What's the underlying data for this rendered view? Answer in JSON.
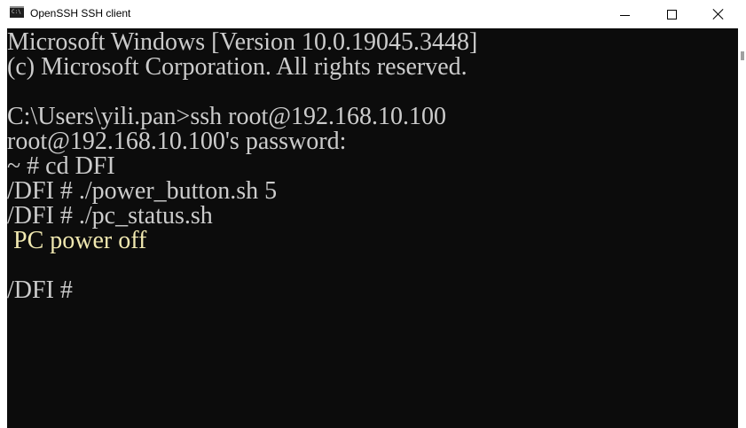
{
  "window": {
    "title": "OpenSSH SSH client",
    "icon": "console-app-icon",
    "icon_glyph": "C:\\"
  },
  "controls": {
    "minimize": "minimize-icon",
    "maximize": "maximize-icon",
    "close": "close-icon"
  },
  "console": {
    "background": "#0c0c0c",
    "text_color": "#cccccc",
    "highlight_color": "#f0e8b0",
    "lines": [
      "Microsoft Windows [Version 10.0.19045.3448]",
      "(c) Microsoft Corporation. All rights reserved.",
      "",
      "C:\\Users\\yili.pan>ssh root@192.168.10.100",
      "root@192.168.10.100's password:",
      "~ # cd DFI",
      "/DFI # ./power_button.sh 5",
      "/DFI # ./pc_status.sh",
      " PC power off",
      "",
      "/DFI # "
    ]
  }
}
